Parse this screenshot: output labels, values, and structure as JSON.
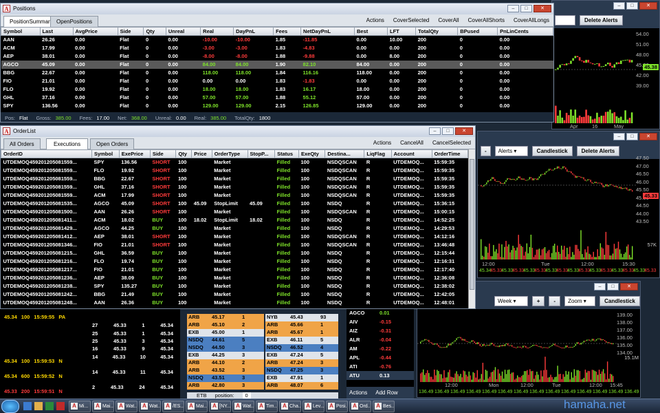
{
  "positions": {
    "title": "Positions",
    "tabs": [
      "PositionSummary",
      "OpenPositions"
    ],
    "actions": [
      "Actions",
      "CoverSelected",
      "CoverAll",
      "CoverAllShorts",
      "CoverAllLongs"
    ],
    "headers": [
      "Symbol",
      "Last",
      "AvgPrice",
      "Side",
      "Qty",
      "Unreal",
      "Real",
      "DayPnL",
      "Fees",
      "NetDayPnL",
      "Best",
      "LFT",
      "TotalQty",
      "BPused",
      "PnLinCents"
    ],
    "rows": [
      [
        "AAN",
        "26.26",
        "0.00",
        "Flat",
        "0",
        "0.00",
        "-10.00",
        "-10.00",
        "1.85",
        "-11.85",
        "0.00",
        "10.00",
        "200",
        "0",
        "0.00"
      ],
      [
        "ACM",
        "17.99",
        "0.00",
        "Flat",
        "0",
        "0.00",
        "-3.00",
        "-3.00",
        "1.83",
        "-4.83",
        "0.00",
        "0.00",
        "200",
        "0",
        "0.00"
      ],
      [
        "AEP",
        "38.01",
        "0.00",
        "Flat",
        "0",
        "0.00",
        "-8.00",
        "-8.00",
        "1.88",
        "-9.88",
        "0.00",
        "8.00",
        "200",
        "0",
        "0.00"
      ],
      [
        "AGCO",
        "45.09",
        "0.00",
        "Flat",
        "0",
        "0.00",
        "84.00",
        "84.00",
        "1.90",
        "82.10",
        "84.00",
        "0.00",
        "200",
        "0",
        "0.00"
      ],
      [
        "BBG",
        "22.67",
        "0.00",
        "Flat",
        "0",
        "0.00",
        "118.00",
        "118.00",
        "1.84",
        "116.16",
        "118.00",
        "0.00",
        "200",
        "0",
        "0.00"
      ],
      [
        "FIO",
        "21.01",
        "0.00",
        "Flat",
        "0",
        "0.00",
        "0.00",
        "0.00",
        "1.83",
        "-1.83",
        "0.00",
        "0.00",
        "200",
        "0",
        "0.00"
      ],
      [
        "FLO",
        "19.92",
        "0.00",
        "Flat",
        "0",
        "0.00",
        "18.00",
        "18.00",
        "1.83",
        "16.17",
        "18.00",
        "0.00",
        "200",
        "0",
        "0.00"
      ],
      [
        "GHL",
        "37.16",
        "0.00",
        "Flat",
        "0",
        "0.00",
        "57.00",
        "57.00",
        "1.88",
        "55.12",
        "57.00",
        "0.00",
        "200",
        "0",
        "0.00"
      ],
      [
        "SPY",
        "136.56",
        "0.00",
        "Flat",
        "0",
        "0.00",
        "129.00",
        "129.00",
        "2.15",
        "126.85",
        "129.00",
        "0.00",
        "200",
        "0",
        "0.00"
      ]
    ],
    "status": [
      [
        "Pos:",
        "Flat"
      ],
      [
        "Gross:",
        "385.00"
      ],
      [
        "Fees:",
        "17.00"
      ],
      [
        "Net:",
        "368.00"
      ],
      [
        "Unreal:",
        "0.00"
      ],
      [
        "Real:",
        "385.00"
      ],
      [
        "TotalQty:",
        "1800"
      ]
    ]
  },
  "orderlist": {
    "title": "OrderList",
    "tabs": [
      "All Orders",
      "Executions",
      "Open Orders"
    ],
    "actions": [
      "Actions",
      "CancelAll",
      "CancelSelected"
    ],
    "headers": [
      "OrderID",
      "Symbol",
      "ExePrice",
      "Side",
      "Qty",
      "Price",
      "OrderType",
      "StopP...",
      "Status",
      "ExeQty",
      "Destina...",
      "LiqFlag",
      "Account",
      "OrderTime"
    ],
    "rows": [
      [
        "UTDEMOQ459201205081559...",
        "SPY",
        "136.56",
        "SHORT",
        "100",
        "",
        "Market",
        "",
        "Filled",
        "100",
        "NSDQSCAN",
        "R",
        "UTDEMOQ...",
        "15:59:35"
      ],
      [
        "UTDEMOQ459201205081559...",
        "FLO",
        "19.92",
        "SHORT",
        "100",
        "",
        "Market",
        "",
        "Filled",
        "100",
        "NSDQSCAN",
        "R",
        "UTDEMOQ...",
        "15:59:35"
      ],
      [
        "UTDEMOQ459201205081559...",
        "BBG",
        "22.67",
        "SHORT",
        "100",
        "",
        "Market",
        "",
        "Filled",
        "100",
        "NSDQSCAN",
        "R",
        "UTDEMOQ...",
        "15:59:35"
      ],
      [
        "UTDEMOQ459201205081559...",
        "GHL",
        "37.16",
        "SHORT",
        "100",
        "",
        "Market",
        "",
        "Filled",
        "100",
        "NSDQSCAN",
        "R",
        "UTDEMOQ...",
        "15:59:35"
      ],
      [
        "UTDEMOQ459201205081559...",
        "ACM",
        "17.99",
        "SHORT",
        "100",
        "",
        "Market",
        "",
        "Filled",
        "100",
        "NSDQSCAN",
        "R",
        "UTDEMOQ...",
        "15:59:35"
      ],
      [
        "UTDEMOQ459201205081535...",
        "AGCO",
        "45.09",
        "SHORT",
        "100",
        "45.09",
        "StopLimit",
        "45.09",
        "Filled",
        "100",
        "NSDQ",
        "R",
        "UTDEMOQ...",
        "15:36:15"
      ],
      [
        "UTDEMOQ459201205081500...",
        "AAN",
        "26.26",
        "SHORT",
        "100",
        "",
        "Market",
        "",
        "Filled",
        "100",
        "NSDQSCAN",
        "R",
        "UTDEMOQ...",
        "15:00:15"
      ],
      [
        "UTDEMOQ459201205081411...",
        "ACM",
        "18.02",
        "BUY",
        "100",
        "18.02",
        "StopLimit",
        "18.02",
        "Filled",
        "100",
        "NSDQ",
        "R",
        "UTDEMOQ...",
        "14:52:25"
      ],
      [
        "UTDEMOQ459201205081429...",
        "AGCO",
        "44.25",
        "BUY",
        "100",
        "",
        "Market",
        "",
        "Filled",
        "100",
        "NSDQ",
        "R",
        "UTDEMOQ...",
        "14:29:53"
      ],
      [
        "UTDEMOQ459201205081412...",
        "AEP",
        "38.01",
        "SHORT",
        "100",
        "",
        "Market",
        "",
        "Filled",
        "100",
        "NSDQSCAN",
        "R",
        "UTDEMOQ...",
        "14:12:16"
      ],
      [
        "UTDEMOQ459201205081346...",
        "FIO",
        "21.01",
        "SHORT",
        "100",
        "",
        "Market",
        "",
        "Filled",
        "100",
        "NSDQSCAN",
        "R",
        "UTDEMOQ...",
        "13:46:48"
      ],
      [
        "UTDEMOQ459201205081215...",
        "GHL",
        "36.59",
        "BUY",
        "100",
        "",
        "Market",
        "",
        "Filled",
        "100",
        "NSDQ",
        "R",
        "UTDEMOQ...",
        "12:15:44"
      ],
      [
        "UTDEMOQ459201205081216...",
        "FLO",
        "19.74",
        "BUY",
        "100",
        "",
        "Market",
        "",
        "Filled",
        "100",
        "NSDQ",
        "R",
        "UTDEMOQ...",
        "12:16:31"
      ],
      [
        "UTDEMOQ459201205081217...",
        "FIO",
        "21.01",
        "BUY",
        "100",
        "",
        "Market",
        "",
        "Filled",
        "100",
        "NSDQ",
        "R",
        "UTDEMOQ...",
        "12:17:40"
      ],
      [
        "UTDEMOQ459201205081236...",
        "AEP",
        "38.09",
        "BUY",
        "100",
        "",
        "Market",
        "",
        "Filled",
        "100",
        "NSDQ",
        "R",
        "UTDEMOQ...",
        "12:36:08"
      ],
      [
        "UTDEMOQ459201205081238...",
        "SPY",
        "135.27",
        "BUY",
        "100",
        "",
        "Market",
        "",
        "Filled",
        "100",
        "NSDQ",
        "R",
        "UTDEMOQ...",
        "12:38:02"
      ],
      [
        "UTDEMOQ459201205081242...",
        "BBG",
        "21.49",
        "BUY",
        "100",
        "",
        "Market",
        "",
        "Filled",
        "100",
        "NSDQ",
        "R",
        "UTDEMOQ...",
        "12:42:05"
      ],
      [
        "UTDEMOQ459201205081248...",
        "AAN",
        "26.36",
        "BUY",
        "100",
        "",
        "Market",
        "",
        "Filled",
        "100",
        "NSDQ",
        "R",
        "UTDEMOQ...",
        "12:48:01"
      ]
    ]
  },
  "chart1": {
    "btn": "Delete Alerts",
    "ticks": [
      "54.00",
      "51.00",
      "48.00",
      "45.00",
      "42.00",
      "39.00"
    ],
    "last": "45.38",
    "xt": [
      "Apr",
      "16",
      "May"
    ]
  },
  "chart2": {
    "minus": "-",
    "alerts": "Alerts",
    "candle": "Candlestick",
    "delete": "Delete Alerts",
    "ticks": [
      "47.50",
      "47.00",
      "46.50",
      "46.00",
      "45.50",
      "45.00",
      "44.50",
      "44.00",
      "43.50"
    ],
    "last": "45.33",
    "vol": "57K",
    "xt": [
      "12:00",
      "Tue",
      "12:00",
      "15:30"
    ],
    "prices": [
      "45.34",
      "45.33",
      "45.33",
      "45.33",
      "45.33",
      "45.33",
      "45.33",
      "45.33",
      "45.33",
      "45.33",
      "45.33",
      "45.33",
      "45.33",
      "45.33",
      "45.33",
      "45.33"
    ]
  },
  "chart3": {
    "week": "Week",
    "plus": "+",
    "minus": "-",
    "zoom": "Zoom",
    "candle": "Candlestick",
    "ticks": [
      "139.00",
      "138.00",
      "137.00",
      "136.00",
      "135.00",
      "134.00"
    ],
    "vol": "15.1M",
    "xt": [
      "12:00",
      "Mon",
      "12:00",
      "Tue",
      "12:00",
      "15:45"
    ],
    "prices": [
      "136.49",
      "136.49",
      "136.49",
      "136.49",
      "136.49",
      "136.49",
      "136.49",
      "136.49",
      "136.49",
      "136.49",
      "136.49",
      "136.49",
      "136.49",
      "136.49"
    ]
  },
  "tape": {
    "rows": [
      [
        "45.34",
        "100",
        "15:59:55",
        "PA"
      ],
      [
        "45.34",
        "100",
        "15:59:53",
        "N"
      ],
      [
        "45.34",
        "600",
        "15:59:52",
        "N"
      ],
      [
        "45.33",
        "200",
        "15:59:51",
        "N"
      ]
    ]
  },
  "book": {
    "rows": [
      [
        "27",
        "45.33",
        "1",
        "45.34"
      ],
      [
        "25",
        "45.33",
        "1",
        "45.34"
      ],
      [
        "25",
        "45.33",
        "3",
        "45.34"
      ],
      [
        "16",
        "45.33",
        "9",
        "45.34"
      ],
      [
        "14",
        "45.33",
        "10",
        "45.34"
      ],
      [
        "14",
        "45.33",
        "11",
        "45.34"
      ],
      [
        "2",
        "45.33",
        "24",
        "45.34"
      ]
    ]
  },
  "level2": {
    "bid": [
      [
        "ARB",
        "45.17",
        "1"
      ],
      [
        "ARB",
        "45.10",
        "2"
      ],
      [
        "EXB",
        "45.00",
        "1"
      ],
      [
        "NSDQ",
        "44.61",
        "5"
      ],
      [
        "NSDQ",
        "44.50",
        "3"
      ],
      [
        "EXB",
        "44.25",
        "3"
      ],
      [
        "ARB",
        "44.10",
        "2"
      ],
      [
        "ARB",
        "43.52",
        "3"
      ],
      [
        "NSDQ",
        "43.51",
        "3"
      ],
      [
        "ARB",
        "42.80",
        "3"
      ]
    ],
    "ask": [
      [
        "NYB",
        "45.43",
        "93"
      ],
      [
        "ARB",
        "45.66",
        "1"
      ],
      [
        "ARB",
        "45.67",
        "1"
      ],
      [
        "EXB",
        "46.11",
        "5"
      ],
      [
        "NSDQ",
        "46.52",
        "4"
      ],
      [
        "EXB",
        "47.24",
        "5"
      ],
      [
        "ARB",
        "47.24",
        "3"
      ],
      [
        "NSDQ",
        "47.25",
        "3"
      ],
      [
        "EXB",
        "47.91",
        "1"
      ],
      [
        "ARB",
        "48.07",
        "6"
      ]
    ],
    "footer": [
      "ETB",
      "position:",
      "0"
    ]
  },
  "watch": {
    "rows": [
      [
        "AGCO",
        "0.01"
      ],
      [
        "AIV",
        "-0.15"
      ],
      [
        "AIZ",
        "-0.31"
      ],
      [
        "ALR",
        "-0.04"
      ],
      [
        "AM",
        "-0.22"
      ],
      [
        "APL",
        "-0.44"
      ],
      [
        "ATI",
        "-0.76"
      ],
      [
        "ATU",
        "0.13"
      ]
    ],
    "actions": "Actions",
    "add": "Add Row"
  },
  "taskbar": [
    "Mi...",
    "Mai...",
    "Wat...",
    "Wat...",
    "/ES...",
    "Mai...",
    "[NY...",
    "Wat...",
    "Tim...",
    "Cha...",
    "Lev...",
    "Posi...",
    "Ord...",
    "Bes..."
  ],
  "watermark": "hamaha.net"
}
